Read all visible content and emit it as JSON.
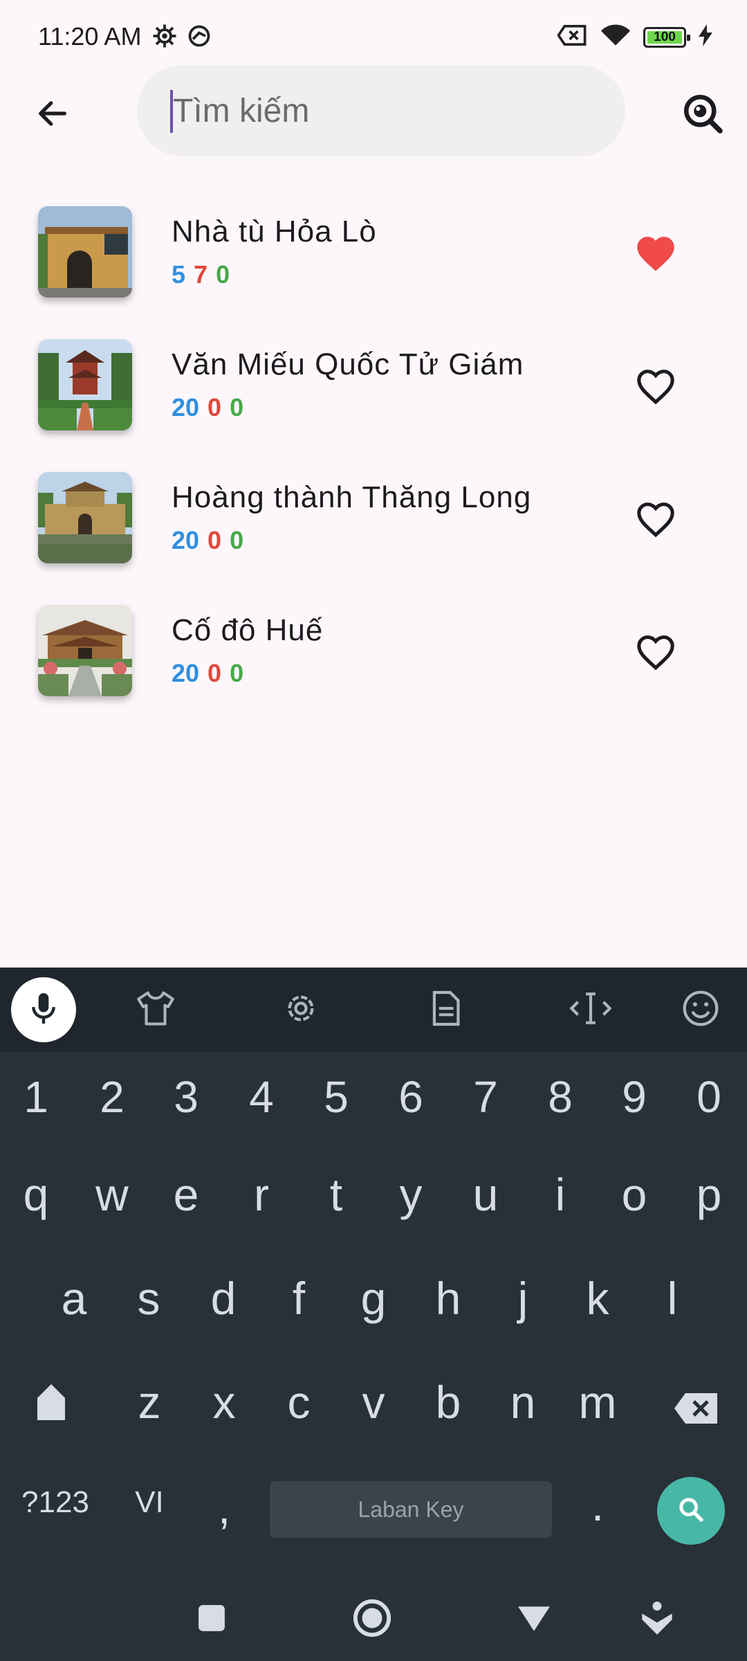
{
  "status_bar": {
    "time": "11:20 AM",
    "battery": "100"
  },
  "search": {
    "placeholder": "Tìm kiếm",
    "value": ""
  },
  "places": [
    {
      "title": "Nhà tù Hỏa Lò",
      "count_blue": "5",
      "count_red": "7",
      "count_green": "0",
      "favorite": true
    },
    {
      "title": "Văn Miếu Quốc Tử Giám",
      "count_blue": "20",
      "count_red": "0",
      "count_green": "0",
      "favorite": false
    },
    {
      "title": "Hoàng thành Thăng Long",
      "count_blue": "20",
      "count_red": "0",
      "count_green": "0",
      "favorite": false
    },
    {
      "title": "Cố đô Huế",
      "count_blue": "20",
      "count_red": "0",
      "count_green": "0",
      "favorite": false
    }
  ],
  "keyboard": {
    "numbers": [
      "1",
      "2",
      "3",
      "4",
      "5",
      "6",
      "7",
      "8",
      "9",
      "0"
    ],
    "row1": [
      "q",
      "w",
      "e",
      "r",
      "t",
      "y",
      "u",
      "i",
      "o",
      "p"
    ],
    "row2": [
      "a",
      "s",
      "d",
      "f",
      "g",
      "h",
      "j",
      "k",
      "l"
    ],
    "row3": [
      "z",
      "x",
      "c",
      "v",
      "b",
      "n",
      "m"
    ],
    "sym_label": "?123",
    "lang_label": "VI",
    "comma": ",",
    "period": ".",
    "space_label": "Laban Key"
  },
  "colors": {
    "favorite": "#f04a4a",
    "accent": "#47b8a6",
    "count_blue": "#2f8fe0",
    "count_red": "#e0483b",
    "count_green": "#46a84a"
  },
  "icons": {
    "back": "arrow-left-icon",
    "visual_search": "image-search-icon",
    "favorite": "heart-icon"
  }
}
